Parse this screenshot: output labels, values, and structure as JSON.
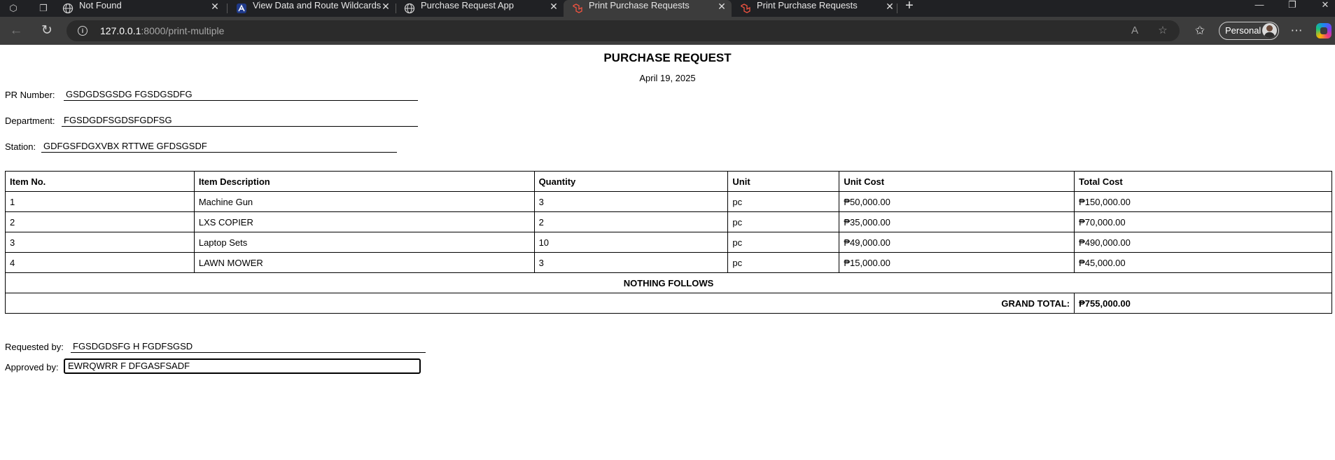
{
  "browser": {
    "tabs": [
      {
        "title": "Not Found",
        "favicon": "globe-icon",
        "active": false
      },
      {
        "title": "View Data and Route Wildcards",
        "favicon": "laravel-a-icon",
        "active": false
      },
      {
        "title": "Purchase Request App",
        "favicon": "globe-icon",
        "active": false
      },
      {
        "title": "Print Purchase Requests",
        "favicon": "laravel-icon",
        "active": true
      },
      {
        "title": "Print Purchase Requests",
        "favicon": "laravel-icon",
        "active": false
      }
    ],
    "url_host": "127.0.0.1",
    "url_rest": ":8000/print-multiple",
    "profile_label": "Personal",
    "accent": "#3c3c3c"
  },
  "document": {
    "title": "PURCHASE REQUEST",
    "date": "April 19, 2025",
    "pr_number_label": "PR Number:",
    "pr_number": "GSDGDSGSDG FGSDGSDFG",
    "department_label": "Department:",
    "department": "FGSDGDFSGDSFGDFSG",
    "station_label": "Station:",
    "station": "GDFGSFDGXVBX RTTWE GFDSGSDF",
    "columns": [
      "Item No.",
      "Item Description",
      "Quantity",
      "Unit",
      "Unit Cost",
      "Total Cost"
    ],
    "items": [
      {
        "no": "1",
        "description": "Machine Gun",
        "quantity": "3",
        "unit": "pc",
        "unit_cost": "₱50,000.00",
        "total_cost": "₱150,000.00"
      },
      {
        "no": "2",
        "description": "LXS COPIER",
        "quantity": "2",
        "unit": "pc",
        "unit_cost": "₱35,000.00",
        "total_cost": "₱70,000.00"
      },
      {
        "no": "3",
        "description": "Laptop Sets",
        "quantity": "10",
        "unit": "pc",
        "unit_cost": "₱49,000.00",
        "total_cost": "₱490,000.00"
      },
      {
        "no": "4",
        "description": "LAWN MOWER",
        "quantity": "3",
        "unit": "pc",
        "unit_cost": "₱15,000.00",
        "total_cost": "₱45,000.00"
      }
    ],
    "nothing_follows": "NOTHING FOLLOWS",
    "grand_total_label": "GRAND TOTAL:",
    "grand_total": "₱755,000.00",
    "requested_by_label": "Requested by:",
    "requested_by": "FGSDGDSFG H FGDFSGSD",
    "approved_by_label": "Approved by:",
    "approved_by": "EWRQWRR F DFGASFSADF"
  }
}
